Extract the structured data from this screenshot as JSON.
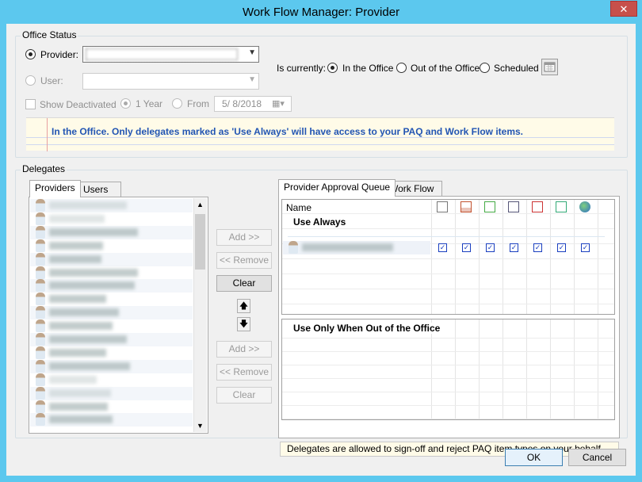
{
  "window": {
    "title": "Work Flow Manager: Provider",
    "close_glyph": "✕"
  },
  "office_status": {
    "group_label": "Office Status",
    "provider_label": "Provider:",
    "provider_value": "",
    "user_label": "User:",
    "show_deactivated_label": "Show Deactivated",
    "one_year_label": "1 Year",
    "from_label": "From",
    "from_date": "5/  8/2018",
    "is_currently_label": "Is currently:",
    "in_office_label": "In the Office",
    "out_office_label": "Out of the Office",
    "scheduled_label": "Scheduled",
    "note": "In the Office.  Only delegates marked as 'Use Always' will have access to your PAQ and Work Flow items."
  },
  "delegates": {
    "group_label": "Delegates",
    "left_tabs": [
      "Providers",
      "Users"
    ],
    "provider_rows": 17,
    "buttons": {
      "add_top": "Add >>",
      "remove_top": "<< Remove",
      "clear_top": "Clear",
      "up_arrow": "🡅",
      "down_arrow": "🡇",
      "add_bottom": "Add >>",
      "remove_bottom": "<< Remove",
      "clear_bottom": "Clear"
    },
    "right_tabs": [
      "Provider Approval Queue",
      "Work Flow"
    ],
    "grid": {
      "name_header": "Name",
      "use_always_label": "Use Always",
      "out_of_office_label": "Use Only When Out of the Office",
      "check_glyph": "☑",
      "header_icons": [
        "document-lines-icon",
        "building-chart-icon",
        "lab-list-icon",
        "note-edit-icon",
        "bar-chart-icon",
        "computer-status-icon",
        "globe-icon"
      ]
    },
    "info": "Delegates are allowed to sign-off and reject PAQ item types on your behalf"
  },
  "footer": {
    "ok": "OK",
    "cancel": "Cancel"
  }
}
